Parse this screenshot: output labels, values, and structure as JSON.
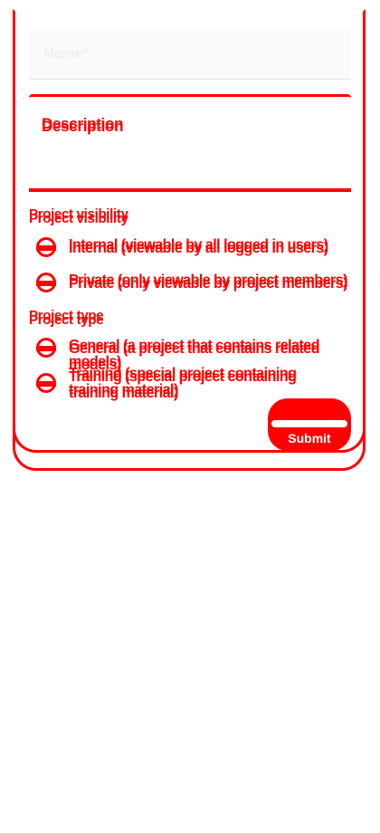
{
  "form": {
    "name_label": "Name*",
    "description_label": "Description",
    "visibility": {
      "label": "Project visibility",
      "options": [
        {
          "label": "Internal (viewable by all logged in users)"
        },
        {
          "label": "Private (only viewable by project members)"
        }
      ]
    },
    "type": {
      "label": "Project type",
      "options": [
        {
          "label": "General (a project that contains related models)"
        },
        {
          "label": "Training (special project containing training material)"
        }
      ]
    },
    "submit_label": "Submit"
  },
  "colors": {
    "accent": "#ff0000",
    "field_background": "#fafafa",
    "page_background": "#ffffff"
  }
}
